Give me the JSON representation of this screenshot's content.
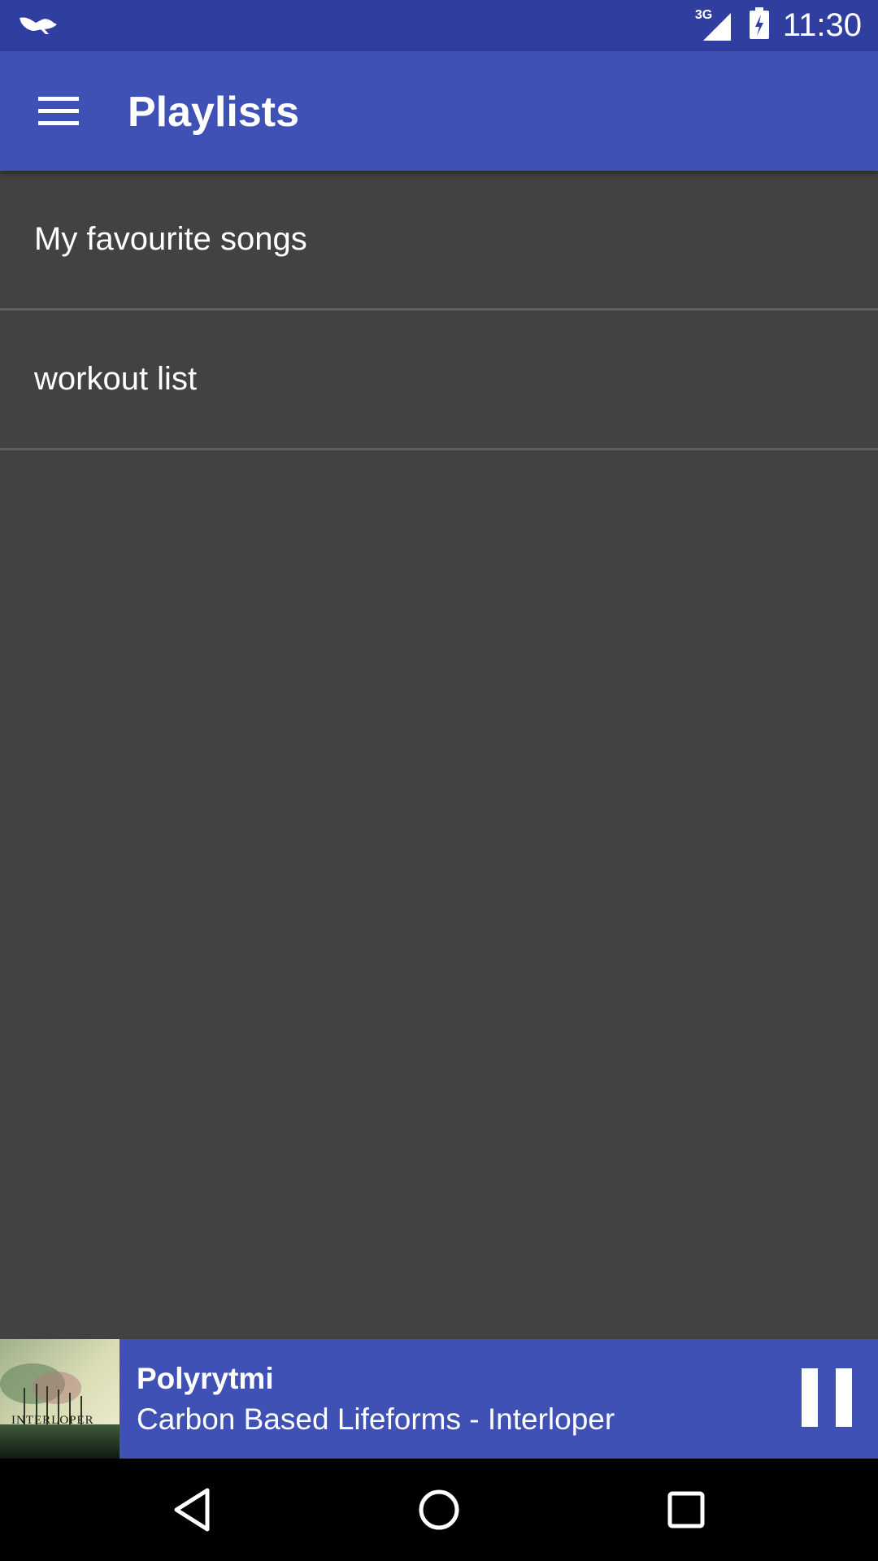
{
  "status_bar": {
    "network_type": "3G",
    "time": "11:30",
    "icons": [
      "bird-notification-icon",
      "signal-icon",
      "battery-charging-icon"
    ]
  },
  "app_bar": {
    "title": "Playlists",
    "menu_icon": "hamburger-menu-icon"
  },
  "playlists": [
    {
      "name": "My favourite songs"
    },
    {
      "name": "workout list"
    }
  ],
  "now_playing": {
    "title": "Polyrytmi",
    "subtitle": "Carbon Based Lifeforms - Interloper",
    "album_art_text": "INTERLOPER",
    "control_icon": "pause-icon"
  },
  "nav_bar": {
    "icons": [
      "back-icon",
      "home-icon",
      "recents-icon"
    ]
  },
  "colors": {
    "primary": "#3F51B5",
    "primary_dark": "#303F9F",
    "background": "#424242",
    "divider": "#5f5f5f"
  }
}
